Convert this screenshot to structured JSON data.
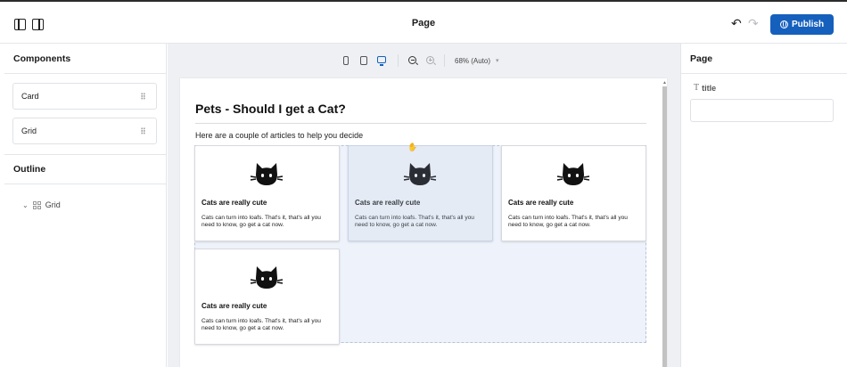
{
  "header": {
    "title": "Page",
    "publish_label": "Publish",
    "undo_glyph": "↶",
    "redo_glyph": "↷"
  },
  "left_sidebar": {
    "components_title": "Components",
    "components": [
      {
        "label": "Card"
      },
      {
        "label": "Grid"
      }
    ],
    "outline_title": "Outline",
    "outline_items": [
      {
        "label": "Grid",
        "chevron": "⌄"
      }
    ]
  },
  "toolbar": {
    "zoom_label": "68% (Auto)",
    "zoom_caret": "▾",
    "active_device": "desktop"
  },
  "preview": {
    "heading": "Pets - Should I get a Cat?",
    "subheading": "Here are a couple of articles to help you decide",
    "cards": [
      {
        "title": "Cats are really cute",
        "text": "Cats can turn into loafs. That's it, that's all you need to know, go get a cat now.",
        "selected": false
      },
      {
        "title": "Cats are really cute",
        "text": "Cats can turn into loafs. That's it, that's all you need to know, go get a cat now.",
        "selected": true
      },
      {
        "title": "Cats are really cute",
        "text": "Cats can turn into loafs. That's it, that's all you need to know, go get a cat now.",
        "selected": false
      },
      {
        "title": "Cats are really cute",
        "text": "Cats can turn into loafs. That's it, that's all you need to know, go get a cat now.",
        "selected": false
      }
    ],
    "cursor_glyph": "✋"
  },
  "right_sidebar": {
    "title": "Page",
    "field_label": "title",
    "field_value": "",
    "field_icon_glyph": "T"
  },
  "colors": {
    "accent": "#1560bd",
    "selected_card": "#e4ebf5",
    "grid_zone": "#eef2fa"
  }
}
